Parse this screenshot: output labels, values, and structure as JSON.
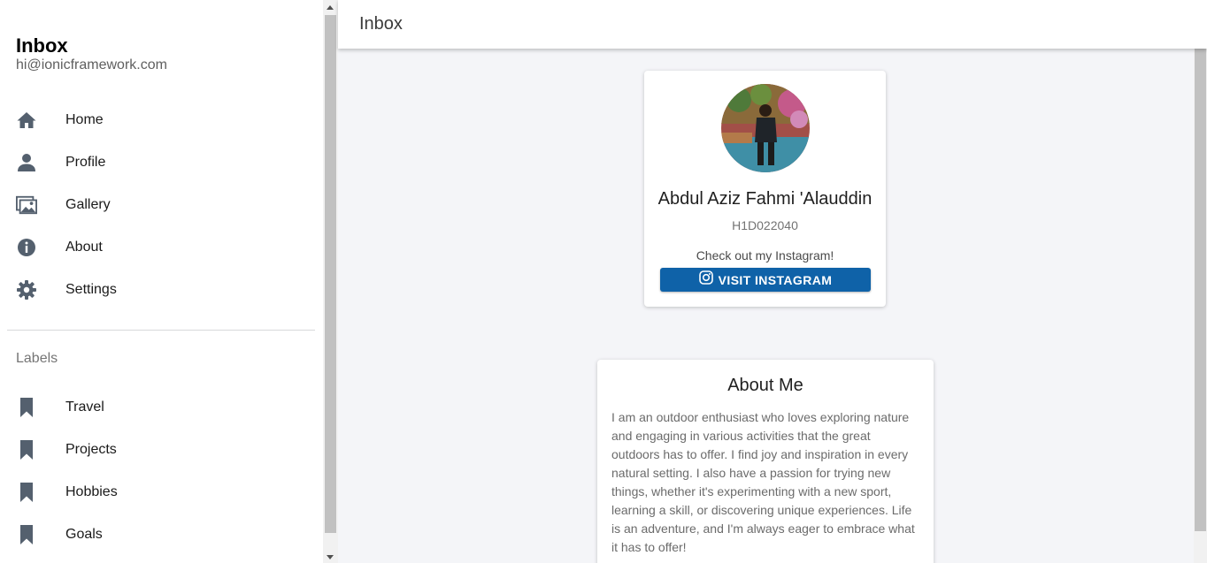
{
  "menu": {
    "title": "Inbox",
    "subtitle": "hi@ionicframework.com",
    "items": [
      {
        "label": "Home",
        "icon": "home-icon"
      },
      {
        "label": "Profile",
        "icon": "person-icon"
      },
      {
        "label": "Gallery",
        "icon": "images-icon"
      },
      {
        "label": "About",
        "icon": "information-icon"
      },
      {
        "label": "Settings",
        "icon": "gear-icon"
      }
    ],
    "labels_heading": "Labels",
    "labels": [
      {
        "label": "Travel",
        "icon": "bookmark-icon"
      },
      {
        "label": "Projects",
        "icon": "bookmark-icon"
      },
      {
        "label": "Hobbies",
        "icon": "bookmark-icon"
      },
      {
        "label": "Goals",
        "icon": "bookmark-icon"
      }
    ]
  },
  "header": {
    "title": "Inbox"
  },
  "profile": {
    "name": "Abdul Aziz Fahmi 'Alauddin",
    "id": "H1D022040",
    "cta_text": "Check out my Instagram!",
    "button_label": "VISIT INSTAGRAM"
  },
  "about": {
    "title": "About Me",
    "text": "I am an outdoor enthusiast who loves exploring nature and engaging in various activities that the great outdoors has to offer. I find joy and inspiration in every natural setting. I also have a passion for trying new things, whether it's experimenting with a new sport, learning a skill, or discovering unique experiences. Life is an adventure, and I'm always eager to embrace what it has to offer!"
  },
  "colors": {
    "icon": "#54606e",
    "button": "#0f62a8",
    "content_bg": "#f4f5f8"
  }
}
